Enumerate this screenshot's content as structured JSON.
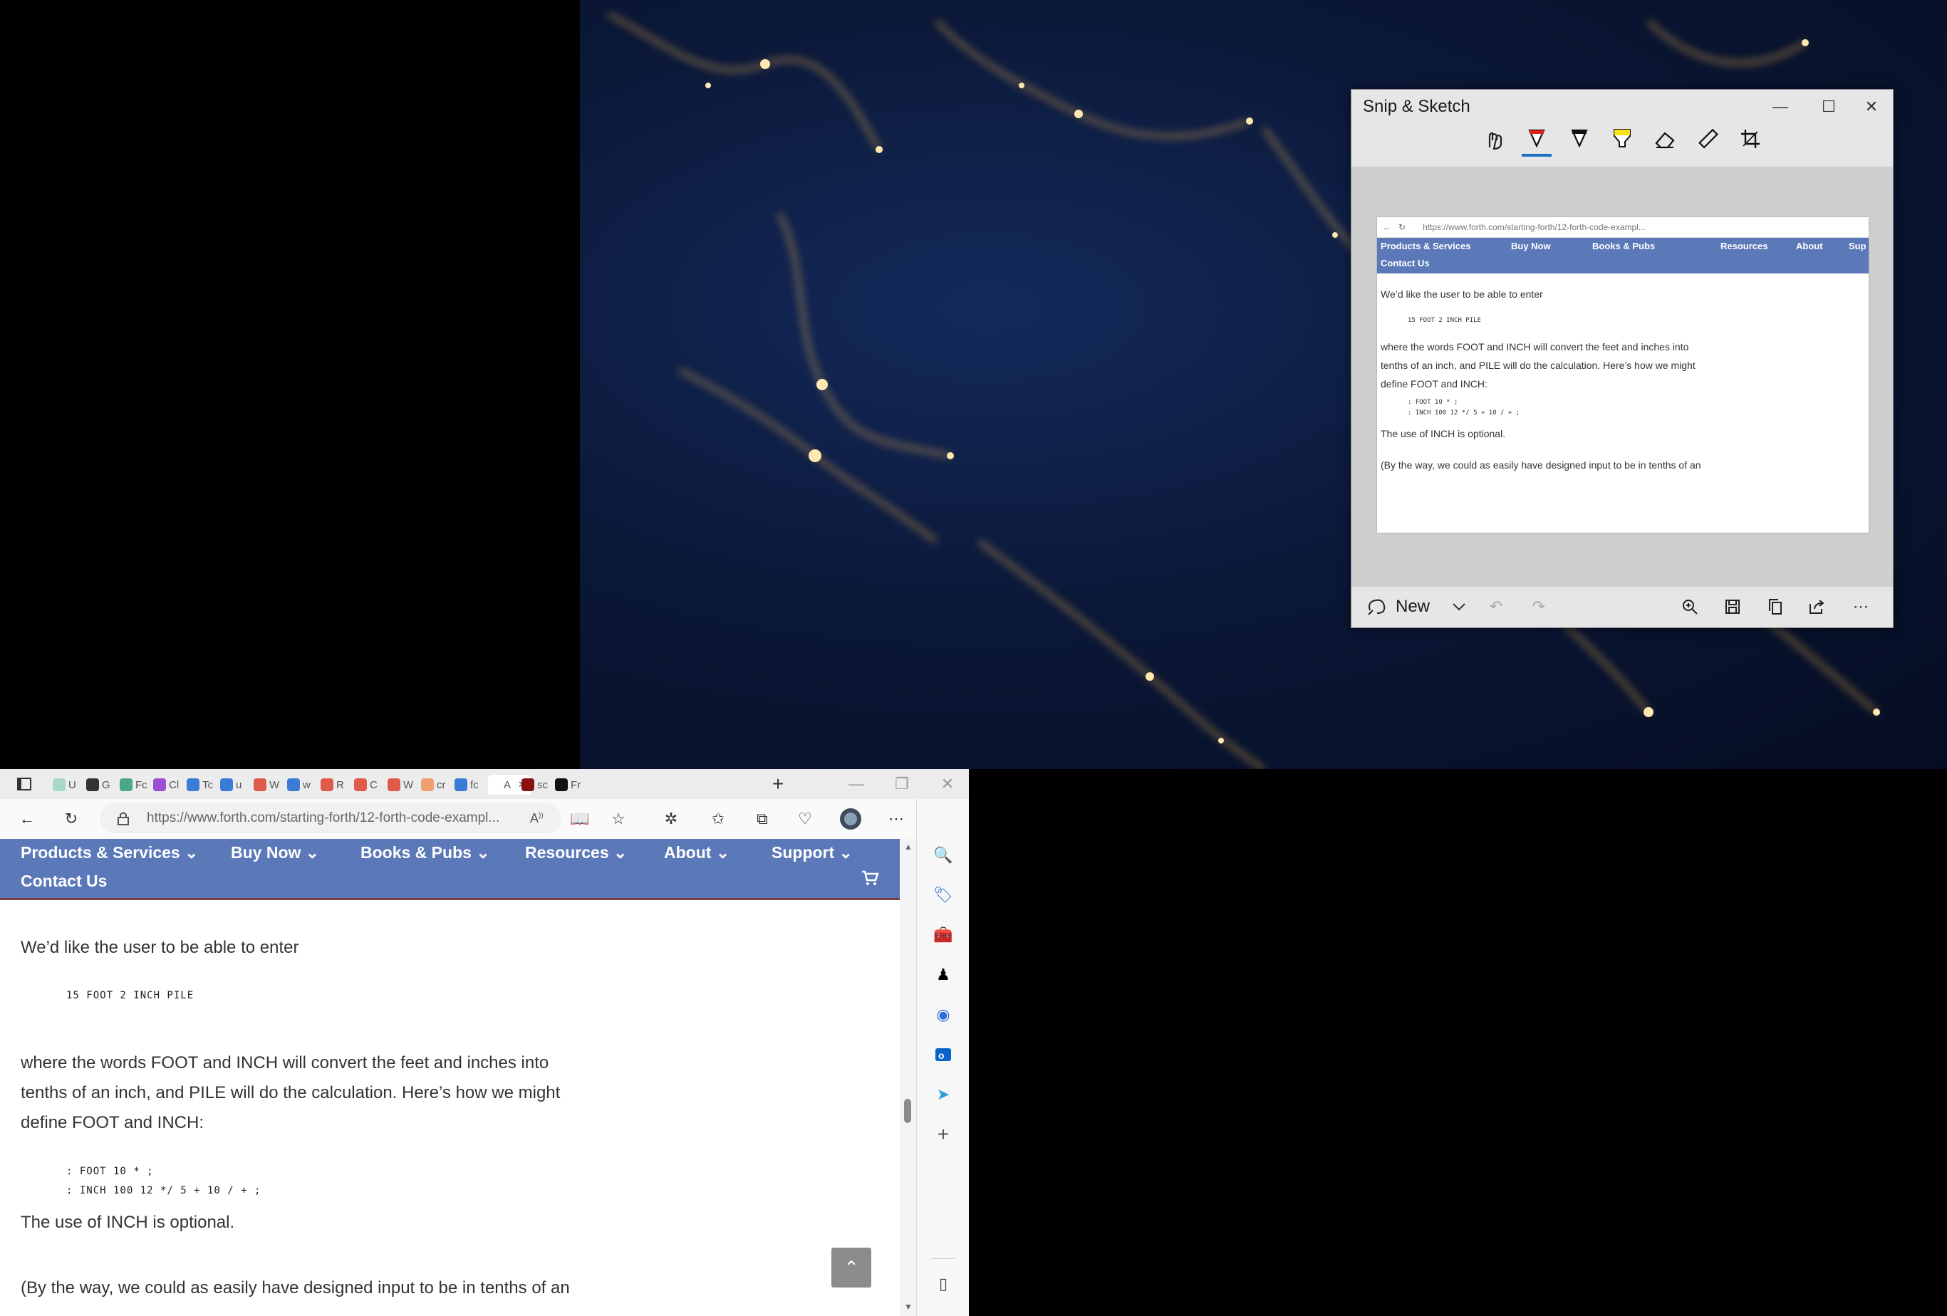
{
  "snip": {
    "title": "Snip & Sketch",
    "minimize": "—",
    "maximize": "☐",
    "close": "✕",
    "new_label": "New",
    "preview": {
      "url": "https://www.forth.com/starting-forth/12-forth-code-exampl...",
      "nav": [
        "Products & Services",
        "Buy Now",
        "Books & Pubs",
        "Resources",
        "About",
        "Sup"
      ],
      "nav_row2": "Contact Us",
      "lines": [
        "We’d like the user to be able to enter",
        "where the words FOOT and INCH will convert the feet and inches into",
        "tenths of an inch, and PILE will do the calculation. Here’s how we might",
        "define FOOT and INCH:",
        "The use of INCH is optional.",
        "(By the way, we could as easily have designed input to be in tenths of an"
      ],
      "code1": "15 FOOT 2 INCH PILE",
      "code2a": ": FOOT 10 * ;",
      "code2b": ": INCH 100 12 */ 5 + 10 / + ;"
    }
  },
  "browser": {
    "url": "https://www.forth.com/starting-forth/12-forth-code-exampl...",
    "tabs": [
      {
        "label": "U",
        "color": "#a8d8c8"
      },
      {
        "label": "G",
        "color": "#333333"
      },
      {
        "label": "Fc",
        "color": "#4aa88a"
      },
      {
        "label": "Cl",
        "color": "#9b4dd6"
      },
      {
        "label": "Tc",
        "color": "#3a7bd5"
      },
      {
        "label": "u",
        "color": "#3a7bd5"
      },
      {
        "label": "W",
        "color": "#e05a4a"
      },
      {
        "label": "w",
        "color": "#3a7bd5"
      },
      {
        "label": "R",
        "color": "#e05a4a"
      },
      {
        "label": "C",
        "color": "#e05a4a"
      },
      {
        "label": "W",
        "color": "#e05a4a"
      },
      {
        "label": "cr",
        "color": "#f0a070"
      },
      {
        "label": "fc",
        "color": "#3a7bd5"
      },
      {
        "label": "A",
        "color": "#ffffff"
      },
      {
        "label": "sc",
        "color": "#8b1010"
      },
      {
        "label": "Fr",
        "color": "#111111"
      }
    ],
    "nav": {
      "products": "Products & Services",
      "buy": "Buy Now",
      "books": "Books & Pubs",
      "resources": "Resources",
      "about": "About",
      "support": "Support",
      "contact": "Contact Us"
    },
    "content": {
      "p1": "We’d like the user to be able to enter",
      "code1": "15 FOOT 2 INCH PILE",
      "p2a": "where the words FOOT and INCH will convert the feet and inches into",
      "p2b": "tenths of an inch, and PILE will do the calculation. Here’s how we might",
      "p2c": "define FOOT and INCH:",
      "code2a": ": FOOT 10 * ;",
      "code2b": ": INCH 100 12 */ 5 + 10 / + ;",
      "p3": "The use of INCH is optional.",
      "p4": "(By the way, we could as easily have designed input to be in tenths of an"
    }
  }
}
